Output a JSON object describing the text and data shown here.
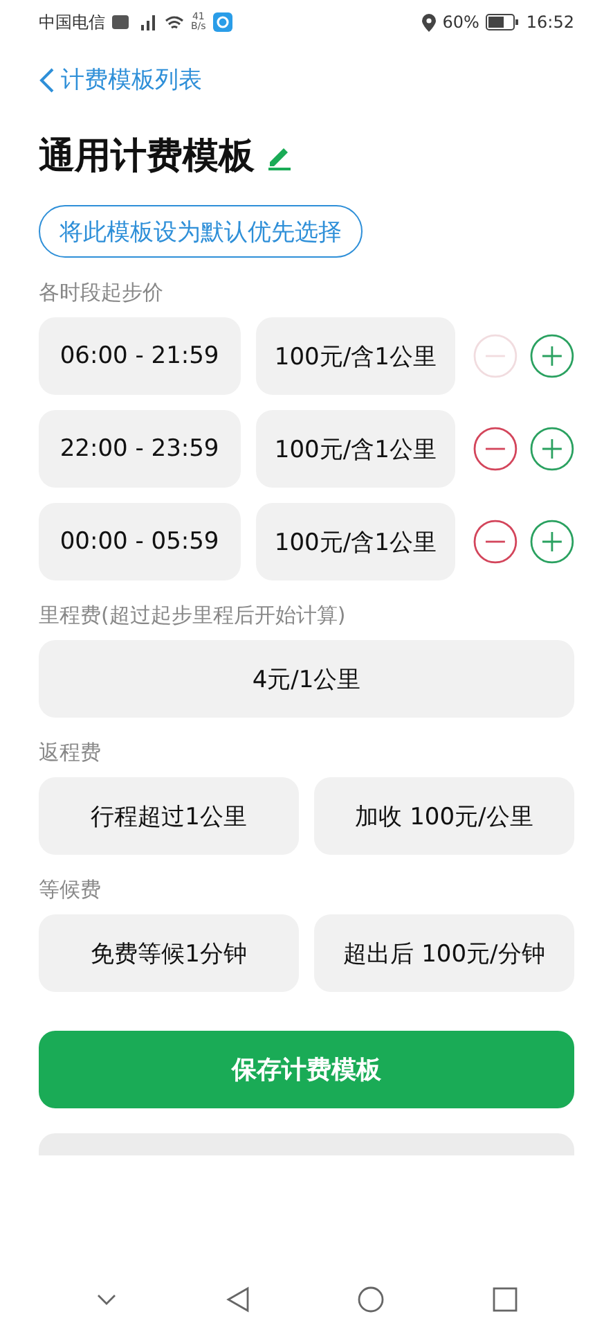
{
  "status_bar": {
    "carrier": "中国电信",
    "network_speed": "41\nB/s",
    "battery": "60%",
    "time": "16:52"
  },
  "back_link": {
    "label": "计费模板列表"
  },
  "title": "通用计费模板",
  "default_button": "将此模板设为默认优先选择",
  "start_price": {
    "label": "各时段起步价",
    "rows": [
      {
        "time": "06:00 - 21:59",
        "price": "100元/含1公里",
        "remove_disabled": true
      },
      {
        "time": "22:00 - 23:59",
        "price": "100元/含1公里",
        "remove_disabled": false
      },
      {
        "time": "00:00 - 05:59",
        "price": "100元/含1公里",
        "remove_disabled": false
      }
    ]
  },
  "mileage_fee": {
    "label": "里程费(超过起步里程后开始计算)",
    "value": "4元/1公里"
  },
  "return_fee": {
    "label": "返程费",
    "values": [
      "行程超过1公里",
      "加收 100元/公里"
    ]
  },
  "waiting_fee": {
    "label": "等候费",
    "values": [
      "免费等候1分钟",
      "超出后 100元/分钟"
    ]
  },
  "save_button": "保存计费模板"
}
